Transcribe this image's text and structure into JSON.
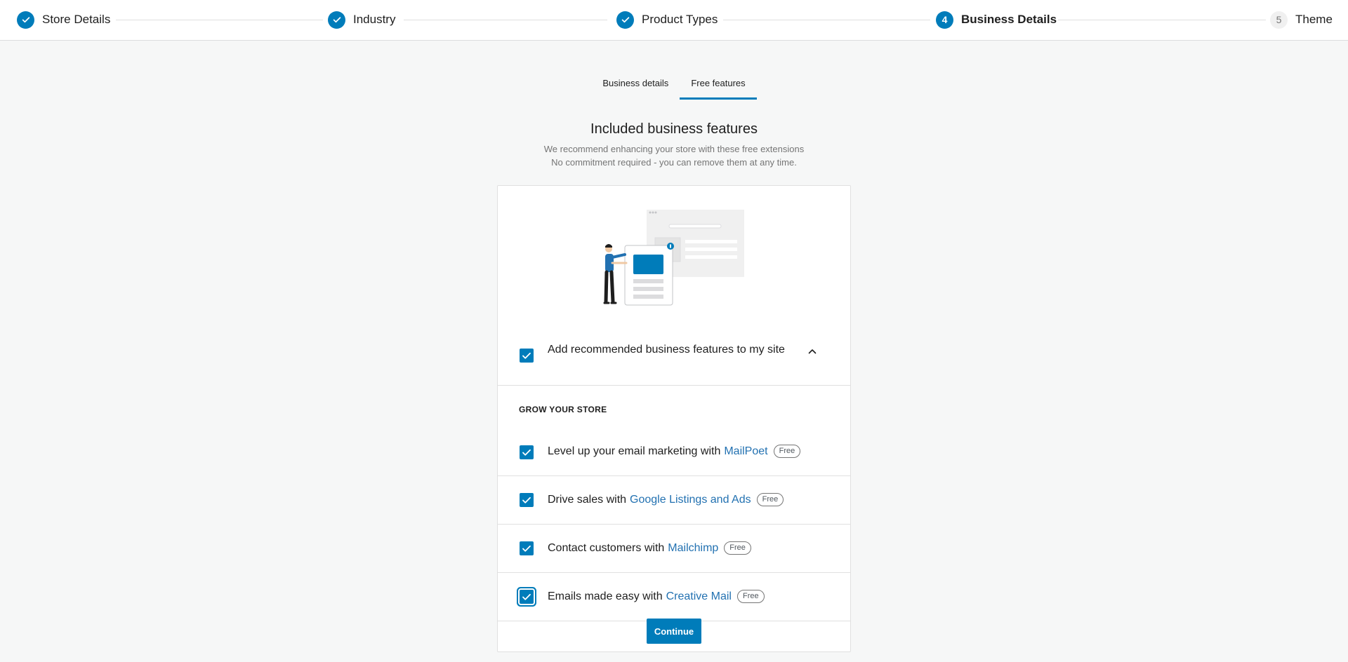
{
  "stepper": {
    "steps": [
      {
        "label": "Store Details",
        "state": "done"
      },
      {
        "label": "Industry",
        "state": "done"
      },
      {
        "label": "Product Types",
        "state": "done"
      },
      {
        "label": "Business Details",
        "state": "active",
        "number": "4"
      },
      {
        "label": "Theme",
        "state": "pending",
        "number": "5"
      }
    ]
  },
  "tabs": [
    {
      "label": "Business details",
      "active": false
    },
    {
      "label": "Free features",
      "active": true
    }
  ],
  "header": {
    "title": "Included business features",
    "subtitle_line1": "We recommend enhancing your store with these free extensions",
    "subtitle_line2": "No commitment required - you can remove them at any time."
  },
  "main_option": {
    "label": "Add recommended business features to my site",
    "checked": true
  },
  "section": {
    "title": "GROW YOUR STORE"
  },
  "extensions": [
    {
      "text": "Level up your email marketing with",
      "link": "MailPoet",
      "badge": "Free",
      "checked": true
    },
    {
      "text": "Drive sales with",
      "link": "Google Listings and Ads",
      "badge": "Free",
      "checked": true
    },
    {
      "text": "Contact customers with",
      "link": "Mailchimp",
      "badge": "Free",
      "checked": true
    },
    {
      "text": "Emails made easy with",
      "link": "Creative Mail",
      "badge": "Free",
      "checked": true
    }
  ],
  "continue_label": "Continue",
  "colors": {
    "accent": "#007cba",
    "link": "#2271b1",
    "background": "#f6f7f7"
  }
}
